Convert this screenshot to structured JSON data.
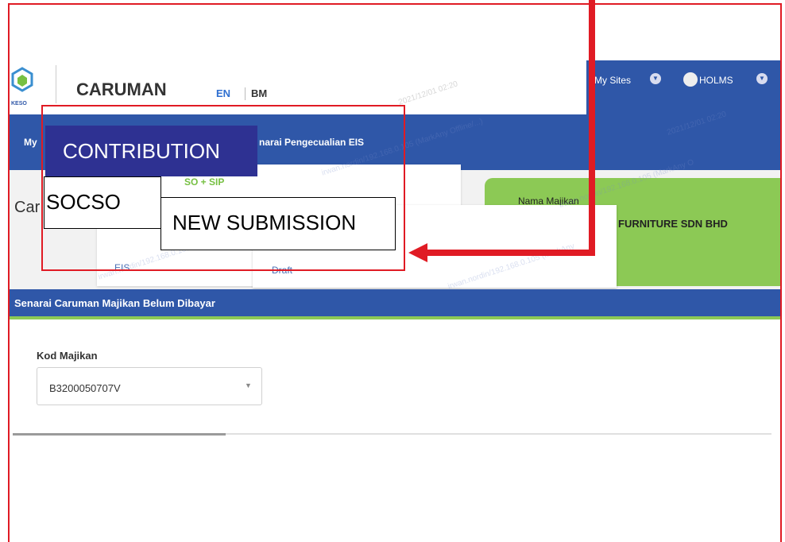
{
  "header": {
    "app_title": "CARUMAN",
    "lang_en": "EN",
    "lang_bm": "BM",
    "my_sites": "My Sites",
    "user": "HOLMS"
  },
  "nav": {
    "item_my": "My",
    "item_eis": "narai Pengecualian EIS"
  },
  "page": {
    "title_prefix": "Car"
  },
  "cards": {
    "socso_sip": "SO + SIP",
    "eis": "EIS",
    "draft": "Draft",
    "nama_majikan": "Nama Majikan",
    "employer_name": "FURNITURE SDN BHD"
  },
  "list": {
    "title": "Senarai Caruman Majikan Belum Dibayar",
    "kod_label": "Kod Majikan",
    "kod_value": "B3200050707V"
  },
  "annotations": {
    "contribution": "CONTRIBUTION",
    "socso": "SOCSO",
    "new_submission": "NEW SUBMISSION"
  },
  "watermarks": {
    "w1": "2021/12/01 02:20",
    "w2": "2021/12/01 02:20",
    "w3": "irwan.nordin/192.168.0.105 (MarkAny Offline/...)",
    "w4": "irwan.nordin/192.168.0.105 (MarkAny O",
    "w5": "irwan.nordin/192.168.0.105 (MarkAny"
  },
  "colors": {
    "brand_blue": "#2f57a8",
    "accent_green": "#8cc955",
    "annotation_red": "#e01b24",
    "label_navy": "#2e3192"
  }
}
